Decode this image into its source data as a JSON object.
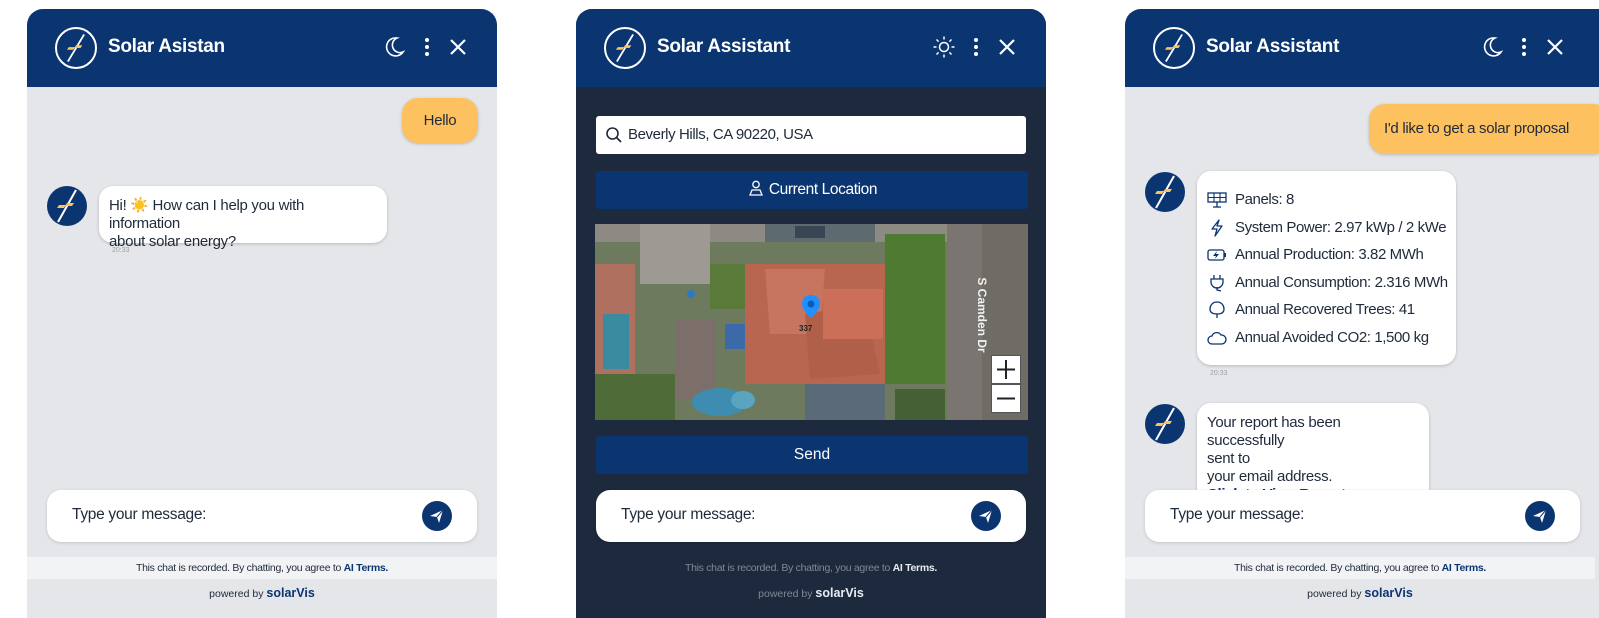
{
  "colors": {
    "brand": "#0b3570",
    "user_bubble": "#fdc160",
    "chat_bg": "#e4e6ea",
    "dark_bg": "#1d2a3d"
  },
  "panel1": {
    "brand": "Solar Asistan",
    "theme_icon": "moon-icon",
    "messages": {
      "user": "Hello",
      "bot_line1": "Hi! ☀️ How can I help you with information",
      "bot_line2": "about solar energy?",
      "time": "20:33"
    },
    "input_placeholder": "Type your message:",
    "footer": {
      "note": "This chat is recorded. By chatting, you agree to ",
      "terms": "AI Terms.",
      "powered_by": "powered by",
      "brand": "solarVis"
    }
  },
  "panel2": {
    "brand": "Solar Assistant",
    "theme_icon": "sun-icon",
    "search_value": "Beverly Hills, CA 90220, USA",
    "location_button": "Current Location",
    "map": {
      "street_label": "S Camden Dr",
      "pin_label": "337"
    },
    "send_button": "Send",
    "input_placeholder": "Type your message:",
    "footer": {
      "note": "This chat is recorded. By chatting, you agree to ",
      "terms": "AI Terms.",
      "powered_by": "powered by",
      "brand": "solarVis"
    }
  },
  "panel3": {
    "brand": "Solar Assistant",
    "theme_icon": "moon-icon",
    "user_message": "I'd like to get a solar proposal",
    "stats": [
      {
        "icon": "solar-panel-icon",
        "text": "Panels: 8"
      },
      {
        "icon": "lightning-icon",
        "text": "System Power: 2.97 kWp / 2 kWe"
      },
      {
        "icon": "battery-charge-icon",
        "text": "Annual Production: 3.82 MWh"
      },
      {
        "icon": "plug-icon",
        "text": "Annual Consumption: 2.316 MWh"
      },
      {
        "icon": "tree-icon",
        "text": "Annual Recovered Trees: 41"
      },
      {
        "icon": "cloud-icon",
        "text": "Annual Avoided CO2: 1,500 kg"
      }
    ],
    "time": "20:33",
    "report": {
      "line1": "Your report has been successfully",
      "line2": "sent to",
      "line3": "your email address.",
      "link": "Click to View Report"
    },
    "input_placeholder": "Type your message:",
    "footer": {
      "note": "This chat is recorded. By chatting, you agree to ",
      "terms": "AI Terms.",
      "powered_by": "powered by",
      "brand": "solarVis"
    }
  }
}
